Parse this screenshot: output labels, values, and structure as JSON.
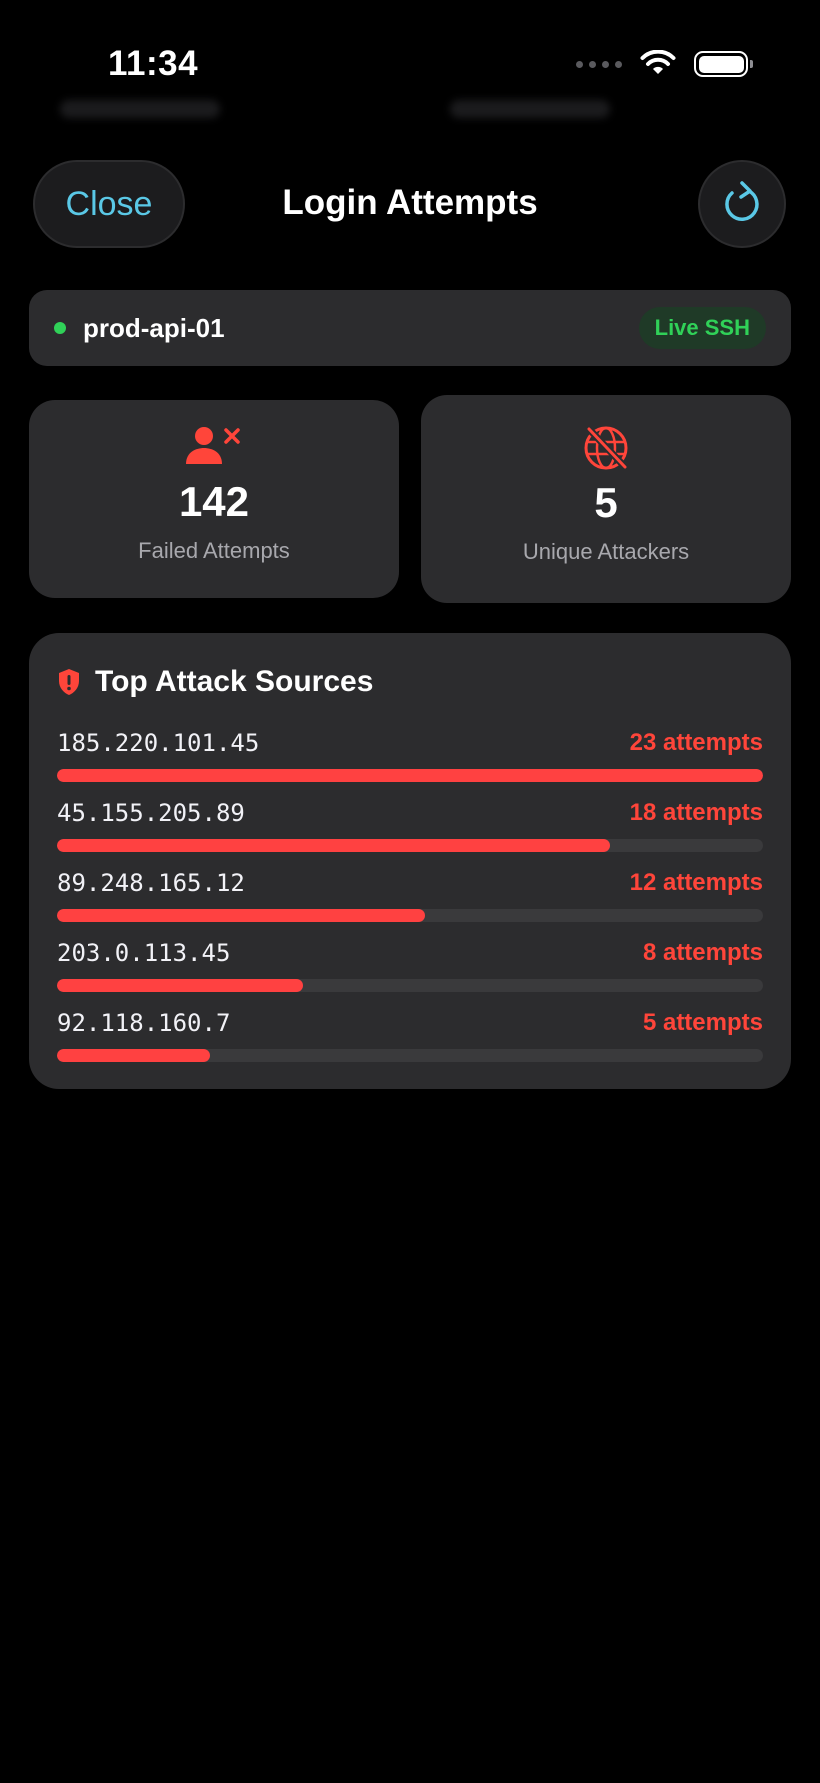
{
  "status_bar": {
    "time": "11:34"
  },
  "header": {
    "close_label": "Close",
    "title": "Login Attempts"
  },
  "server": {
    "name": "prod-api-01",
    "badge": "Live SSH"
  },
  "stats": {
    "failed": {
      "value": "142",
      "label": "Failed Attempts"
    },
    "unique": {
      "value": "5",
      "label": "Unique Attackers"
    }
  },
  "sources": {
    "title": "Top Attack Sources",
    "items": [
      {
        "ip": "185.220.101.45",
        "attempts": "23 attempts",
        "count": 23
      },
      {
        "ip": "45.155.205.89",
        "attempts": "18 attempts",
        "count": 18
      },
      {
        "ip": "89.248.165.12",
        "attempts": "12 attempts",
        "count": 12
      },
      {
        "ip": "203.0.113.45",
        "attempts": "8 attempts",
        "count": 8
      },
      {
        "ip": "92.118.160.7",
        "attempts": "5 attempts",
        "count": 5
      }
    ]
  },
  "colors": {
    "accent": "#5ac8e6",
    "danger": "#ff453a",
    "live": "#30d158",
    "card": "#2c2c2e"
  }
}
